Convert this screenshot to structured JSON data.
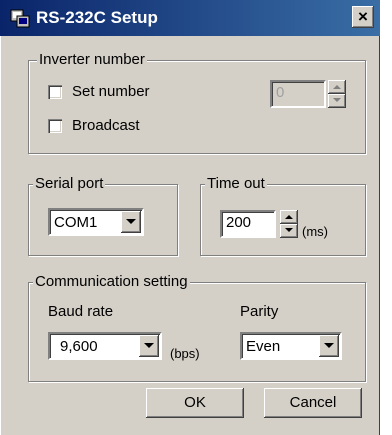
{
  "window": {
    "title": "RS-232C Setup",
    "close_glyph": "×"
  },
  "inverter_number": {
    "legend": "Inverter number",
    "set_number_label": "Set number",
    "set_number_checked": false,
    "number_value": "0",
    "broadcast_label": "Broadcast",
    "broadcast_checked": false
  },
  "serial_port": {
    "legend": "Serial port",
    "selected": "COM1"
  },
  "time_out": {
    "legend": "Time out",
    "value": "200",
    "unit": "(ms)"
  },
  "communication": {
    "legend": "Communication setting",
    "baud_rate_label": "Baud rate",
    "baud_rate_value": "9,600",
    "baud_unit": "(bps)",
    "parity_label": "Parity",
    "parity_value": "Even"
  },
  "buttons": {
    "ok": "OK",
    "cancel": "Cancel"
  },
  "icons": {
    "app": "app-window-icon",
    "close": "close-icon",
    "spin_up": "arrow-up-icon",
    "spin_down": "arrow-down-icon",
    "dropdown": "chevron-down-icon"
  },
  "colors": {
    "titlebar_start": "#0a246a",
    "titlebar_end": "#3a6ea5",
    "face": "#d4d0c8"
  }
}
